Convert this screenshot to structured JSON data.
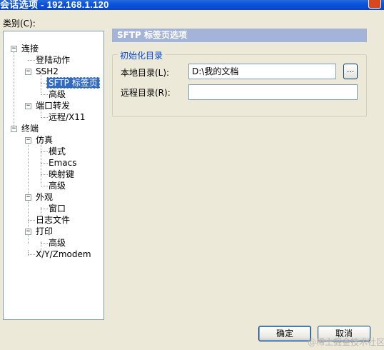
{
  "window": {
    "title": "会话选项 - 192.168.1.120"
  },
  "category_label": "类别(C):",
  "tree": {
    "connection": "连接",
    "login_actions": "登陆动作",
    "ssh2": "SSH2",
    "sftp_tab": "SFTP 标签页",
    "ssh2_advanced": "高级",
    "port_forwarding": "端口转发",
    "remote_x11": "远程/X11",
    "terminal": "终端",
    "emulation": "仿真",
    "modes": "模式",
    "emacs": "Emacs",
    "mapped_keys": "映射键",
    "emulation_advanced": "高级",
    "appearance": "外观",
    "window": "窗口",
    "log_file": "日志文件",
    "printing": "打印",
    "printing_advanced": "高级",
    "xyzmodem": "X/Y/Zmodem"
  },
  "panel": {
    "header": "SFTP 标签页选项",
    "group_title": "初始化目录",
    "local_dir_label": "本地目录(L):",
    "local_dir_value": "D:\\我的文档",
    "remote_dir_label": "远程目录(R):",
    "remote_dir_value": "",
    "browse_label": "..."
  },
  "buttons": {
    "ok": "确定",
    "cancel": "取消"
  },
  "watermark": "@稀土掘金技术社区"
}
